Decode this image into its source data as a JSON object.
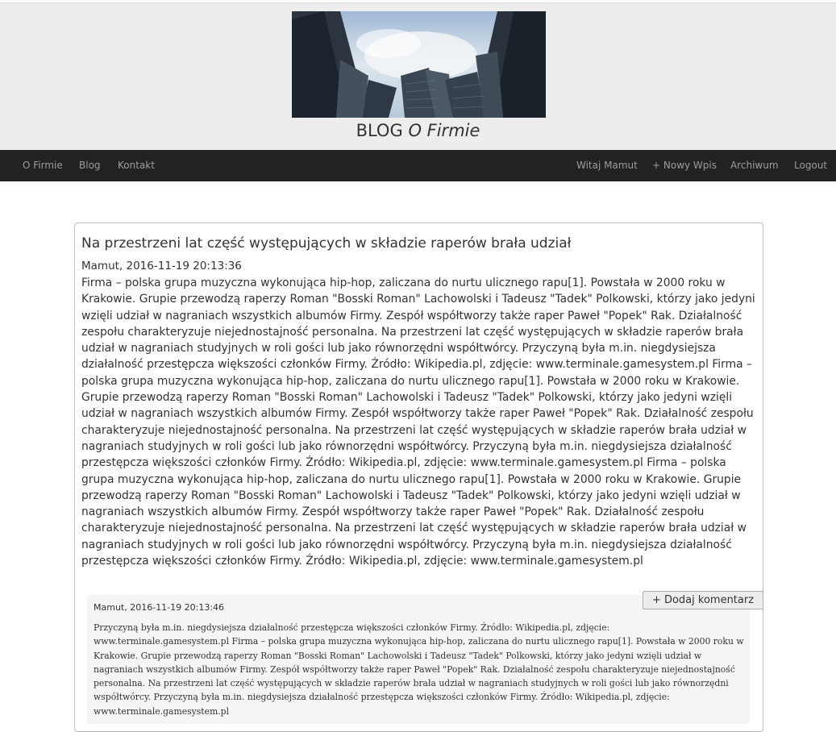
{
  "site": {
    "title_plain": "BLOG",
    "title_italic": "O Firmie"
  },
  "hero_image": {
    "icon": "skyscrapers-photo"
  },
  "navbar": {
    "left": [
      "O Firmie",
      "Blog",
      "Kontakt"
    ],
    "right": [
      "Witaj Mamut",
      "+ Nowy Wpis",
      "Archiwum",
      "Logout"
    ]
  },
  "post": {
    "title": "Na przestrzeni lat część występujących w składzie raperów brała udział",
    "meta": "Mamut, 2016-11-19 20:13:36",
    "body": "Firma – polska grupa muzyczna wykonująca hip-hop, zaliczana do nurtu ulicznego rapu[1]. Powstała w 2000 roku w Krakowie. Grupie przewodzą raperzy Roman \"Bosski Roman\" Lachowolski i Tadeusz \"Tadek\" Polkowski, którzy jako jedyni wzięli udział w nagraniach wszystkich albumów Firmy. Zespół współtworzy także raper Paweł \"Popek\" Rak. Działalność zespołu charakteryzuje niejednostajność personalna. Na przestrzeni lat część występujących w składzie raperów brała udział w nagraniach studyjnych w roli gości lub jako równorzędni współtwórcy. Przyczyną była m.in. niegdysiejsza działalność przestępcza większości członków Firmy. Źródło: Wikipedia.pl, zdjęcie: www.terminale.gamesystem.pl Firma – polska grupa muzyczna wykonująca hip-hop, zaliczana do nurtu ulicznego rapu[1]. Powstała w 2000 roku w Krakowie. Grupie przewodzą raperzy Roman \"Bosski Roman\" Lachowolski i Tadeusz \"Tadek\" Polkowski, którzy jako jedyni wzięli udział w nagraniach wszystkich albumów Firmy. Zespół współtworzy także raper Paweł \"Popek\" Rak. Działalność zespołu charakteryzuje niejednostajność personalna. Na przestrzeni lat część występujących w składzie raperów brała udział w nagraniach studyjnych w roli gości lub jako równorzędni współtwórcy. Przyczyną była m.in. niegdysiejsza działalność przestępcza większości członków Firmy. Źródło: Wikipedia.pl, zdjęcie: www.terminale.gamesystem.pl Firma – polska grupa muzyczna wykonująca hip-hop, zaliczana do nurtu ulicznego rapu[1]. Powstała w 2000 roku w Krakowie. Grupie przewodzą raperzy Roman \"Bosski Roman\" Lachowolski i Tadeusz \"Tadek\" Polkowski, którzy jako jedyni wzięli udział w nagraniach wszystkich albumów Firmy. Zespół współtworzy także raper Paweł \"Popek\" Rak. Działalność zespołu charakteryzuje niejednostajność personalna. Na przestrzeni lat część występujących w składzie raperów brała udział w nagraniach studyjnych w roli gości lub jako równorzędni współtwórcy. Przyczyną była m.in. niegdysiejsza działalność przestępcza większości członków Firmy. Źródło: Wikipedia.pl, zdjęcie: www.terminale.gamesystem.pl",
    "add_comment_label": "+ Dodaj komentarz"
  },
  "comment": {
    "meta": "Mamut, 2016-11-19 20:13:46",
    "body": "Przyczyną była m.in. niegdysiejsza działalność przestępcza większości członków Firmy. Źródło: Wikipedia.pl, zdjęcie: www.terminale.gamesystem.pl Firma – polska grupa muzyczna wykonująca hip-hop, zaliczana do nurtu ulicznego rapu[1]. Powstała w 2000 roku w Krakowie. Grupie przewodzą raperzy Roman \"Bosski Roman\" Lachowolski i Tadeusz \"Tadek\" Polkowski, którzy jako jedyni wzięli udział w nagraniach wszystkich albumów Firmy. Zespół współtworzy także raper Paweł \"Popek\" Rak. Działalność zespołu charakteryzuje niejednostajność personalna. Na przestrzeni lat część występujących w składzie raperów brała udział w nagraniach studyjnych w roli gości lub jako równorzędni współtwórcy. Przyczyną była m.in. niegdysiejsza działalność przestępcza większości członków Firmy. Źródło: Wikipedia.pl, zdjęcie: www.terminale.gamesystem.pl"
  }
}
